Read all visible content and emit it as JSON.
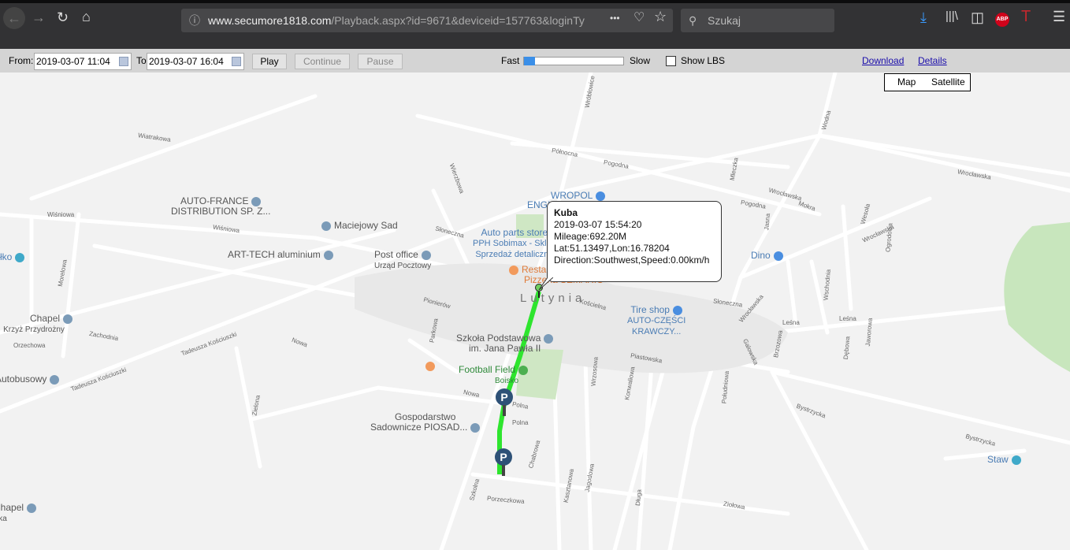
{
  "browser": {
    "url_domain": "www.secumore1818.com",
    "url_path": "/Playback.aspx?id=9671&deviceid=157763&loginTy",
    "search_placeholder": "Szukaj",
    "more_icon": "•••",
    "abp_label": "ABP"
  },
  "toolbar": {
    "from_label": "From:",
    "from_value": "2019-03-07 11:04",
    "to_label": "To",
    "to_value": "2019-03-07 16:04",
    "play": "Play",
    "continue": "Continue",
    "pause": "Pause",
    "fast": "Fast",
    "slow": "Slow",
    "speed_value": 0,
    "show_lbs": "Show LBS",
    "show_lbs_checked": false,
    "download": "Download",
    "details": "Details"
  },
  "map": {
    "map_type": [
      "Map",
      "Satellite"
    ],
    "town": "Lutynia",
    "pois": [
      "AUTO-FRANCE",
      "DISTRIBUTION SP. Z...",
      "Maciejowy Sad",
      "ART-TECH aluminium",
      "Post office",
      "Urząd Pocztowy",
      "Auto parts store",
      "PPH Sobimax - Sklep",
      "Sprzedaż detaliczna",
      "Restauracja",
      "Pizzeria SEMARIO",
      "ENGIE",
      "WROPOL",
      "Dino",
      "Tire shop",
      "AUTO-CZĘŚCI",
      "KRAWCZY...",
      "Szkoła Podstawowa",
      "im. Jana Pawła II",
      "Football Field",
      "Boisko",
      "Gospodarstwo",
      "Sadownicze PIOSAD...",
      "Chapel",
      "Krzyż Przydrożny",
      "Autobusowy",
      "Staw",
      "Chapel",
      "Kapliczka",
      "Ełko"
    ],
    "streets": [
      "Wiatrakowa",
      "Wiśniowa",
      "Wiśniowa",
      "Morelowa",
      "Zachodnia",
      "Orzechowa",
      "Tadeusza Kościuszki",
      "Tadeusza Kościuszki",
      "Nowa",
      "Nowa",
      "Polna",
      "Zielona",
      "Pionierów",
      "Parkowa",
      "Wierzbowa",
      "Słoneczna",
      "Słoneczna",
      "Kościelna",
      "Północna",
      "Pogodna",
      "Pogodna",
      "Wróblowice",
      "Mleczka",
      "Wodna",
      "Wrocławska",
      "Wrocławska",
      "Wrocławska",
      "Wrocławska",
      "Leśna",
      "Leśna",
      "Piastowska",
      "Polna",
      "Szkolna",
      "Chabrowa",
      "Kasztanowa",
      "Jagodowa",
      "Długa",
      "Ziołowa",
      "Porzeczkowa",
      "Konwaliowa",
      "Wrzosowa",
      "Południowa",
      "Galowska",
      "Brzozowa",
      "Bystrzycka",
      "Bystrzycka",
      "Wschodnia",
      "Dębowa",
      "Jaworowa",
      "Ogrodowa",
      "Jasna",
      "Mokra",
      "Wesoła"
    ]
  },
  "popup": {
    "name": "Kuba",
    "time": "2019-03-07 15:54:20",
    "mileage": "Mileage:692.20M",
    "latlon": "Lat:51.13497,Lon:16.78204",
    "direction": "Direction:Southwest,Speed:0.00km/h"
  },
  "track": {
    "color": "#2ee52e"
  },
  "parking": {
    "label": "P"
  }
}
